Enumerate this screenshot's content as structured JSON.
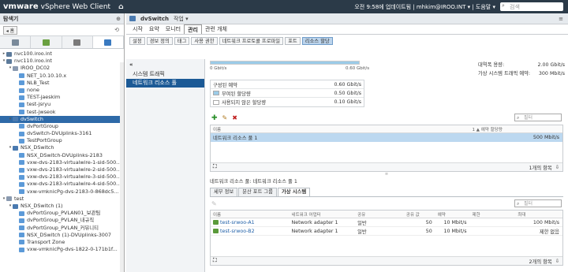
{
  "topbar": {
    "brand_vm": "vmware",
    "brand_product": "vSphere Web Client",
    "user_info": "오전 9:58에 업데이트됨 | mhkim@IROO.INT ▾ | 도움말 ▾",
    "search_placeholder": "검색"
  },
  "nav": {
    "title": "탐색기",
    "back_label": "◂ 홈",
    "tree": [
      {
        "label": "nvc100.iroo.int",
        "indent": 0,
        "tog": "▸",
        "color": "#5c7a9a"
      },
      {
        "label": "nvc110.iroo.int",
        "indent": 0,
        "tog": "▾",
        "color": "#5c7a9a"
      },
      {
        "label": "IROO_DC02",
        "indent": 1,
        "tog": "▾",
        "color": "#8a9ab0"
      },
      {
        "label": "NET_10.10.10.x",
        "indent": 2,
        "tog": "",
        "color": "#5c9ad8"
      },
      {
        "label": "NLB_Test",
        "indent": 2,
        "tog": "",
        "color": "#5c9ad8"
      },
      {
        "label": "none",
        "indent": 2,
        "tog": "",
        "color": "#5c9ad8"
      },
      {
        "label": "TEST-jaeskim",
        "indent": 2,
        "tog": "",
        "color": "#5c9ad8"
      },
      {
        "label": "test-jsryu",
        "indent": 2,
        "tog": "",
        "color": "#5c9ad8"
      },
      {
        "label": "test-jwseok",
        "indent": 2,
        "tog": "",
        "color": "#5c9ad8"
      },
      {
        "label": "dvSwitch",
        "indent": 1,
        "tog": "▾",
        "color": "#4a7ab0",
        "selected": true
      },
      {
        "label": "dvPortGroup",
        "indent": 2,
        "tog": "",
        "color": "#5c9ad8"
      },
      {
        "label": "dvSwitch-DVUplinks-3161",
        "indent": 2,
        "tog": "",
        "color": "#5c9ad8"
      },
      {
        "label": "TestPortGroup",
        "indent": 2,
        "tog": "",
        "color": "#5c9ad8"
      },
      {
        "label": "NSX_DSwitch",
        "indent": 1,
        "tog": "▾",
        "color": "#4a7ab0"
      },
      {
        "label": "NSX_DSwitch-DVUplinks-2183",
        "indent": 2,
        "tog": "",
        "color": "#5c9ad8"
      },
      {
        "label": "vxw-dvs-2183-virtualwire-1-sid-500...",
        "indent": 2,
        "tog": "",
        "color": "#5c9ad8"
      },
      {
        "label": "vxw-dvs-2183-virtualwire-2-sid-500...",
        "indent": 2,
        "tog": "",
        "color": "#5c9ad8"
      },
      {
        "label": "vxw-dvs-2183-virtualwire-3-sid-500...",
        "indent": 2,
        "tog": "",
        "color": "#5c9ad8"
      },
      {
        "label": "vxw-dvs-2183-virtualwire-4-sid-500...",
        "indent": 2,
        "tog": "",
        "color": "#5c9ad8"
      },
      {
        "label": "vxw-vmknicPg-dvs-2183-0-868dc5...",
        "indent": 2,
        "tog": "",
        "color": "#5c9ad8"
      },
      {
        "label": "test",
        "indent": 0,
        "tog": "▾",
        "color": "#8a9ab0"
      },
      {
        "label": "NSX_DSwitch (1)",
        "indent": 1,
        "tog": "▾",
        "color": "#4a7ab0"
      },
      {
        "label": "dvPortGroup_PVLAN01_보관팀",
        "indent": 2,
        "tog": "",
        "color": "#5c9ad8"
      },
      {
        "label": "dvPortGroup_PVLAN_내규직",
        "indent": 2,
        "tog": "",
        "color": "#5c9ad8"
      },
      {
        "label": "dvPortGroup_PVLAN_커뮤니티",
        "indent": 2,
        "tog": "",
        "color": "#5c9ad8"
      },
      {
        "label": "NSX_DSwitch (1)-DVUplinks-3007",
        "indent": 2,
        "tog": "",
        "color": "#5c9ad8"
      },
      {
        "label": "Transport Zone",
        "indent": 2,
        "tog": "",
        "color": "#5c9ad8"
      },
      {
        "label": "vxw-vmknicPg-dvs-1822-0-171b1f...",
        "indent": 2,
        "tog": "",
        "color": "#5c9ad8"
      }
    ]
  },
  "object": {
    "name": "dvSwitch",
    "actions_label": "작업 ▾",
    "tabs": [
      "시작",
      "요약",
      "모니터",
      "관리",
      "관련 개체"
    ],
    "active_tab": 3,
    "sub_tabs": [
      "설정",
      "경보 정의",
      "태그",
      "사용 권한",
      "네트워크 프로토콜 프로파일",
      "포트",
      "리소스 할당"
    ],
    "active_sub_tab": 6
  },
  "left_menu": {
    "items": [
      "시스템 트래픽",
      "네트워크 리소스 풀"
    ],
    "active": 1
  },
  "capacity": {
    "bar_fill_fraction": 1.0,
    "left_label": "0 Gbit/s",
    "right_label": "0.60 Gbit/s",
    "summary": [
      {
        "k": "대역폭 용량:",
        "v": "2.00 Gbit/s"
      },
      {
        "k": "가상 시스템 트래픽 예약:",
        "v": "300 Mbit/s"
      }
    ],
    "rows": [
      {
        "label": "구성된 예약",
        "value": "0.60 Gbit/s",
        "swatch": ""
      },
      {
        "label": "부여된 할당량",
        "value": "0.50 Gbit/s",
        "swatch": "#9bcbe8"
      },
      {
        "label": "사용되지 않은 할당량",
        "value": "0.10 Gbit/s",
        "swatch": "#ffffff"
      }
    ]
  },
  "pools": {
    "filter_placeholder": "필터",
    "headers": [
      "이름",
      "1 ▲ 예약 할당량"
    ],
    "rows": [
      {
        "name": "네트워크 리소스 풀 1",
        "value": "500 Mbit/s"
      }
    ],
    "footer": "1개의 항목"
  },
  "detail": {
    "title": "네트워크 리소스 풀: 네트워크 리소스 풀 1",
    "tabs": [
      "세부 정보",
      "분산 포트 그룹",
      "가상 시스템"
    ],
    "active_tab": 2,
    "filter_placeholder": "필터",
    "headers": [
      "이름",
      "네트워크 어댑터",
      "공유",
      "공유 값",
      "예약",
      "제한",
      "최대"
    ],
    "rows": [
      {
        "name": "test-srwoo-A1",
        "adapter": "Network adapter 1",
        "share": "일반",
        "share_val": "50",
        "reserve": "10 Mbit/s",
        "limit": "",
        "max": "100 Mbit/s"
      },
      {
        "name": "test-srwoo-B2",
        "adapter": "Network adapter 1",
        "share": "일반",
        "share_val": "50",
        "reserve": "10 Mbit/s",
        "limit": "",
        "max": "제한 없음"
      }
    ],
    "footer": "2개의 항목"
  }
}
